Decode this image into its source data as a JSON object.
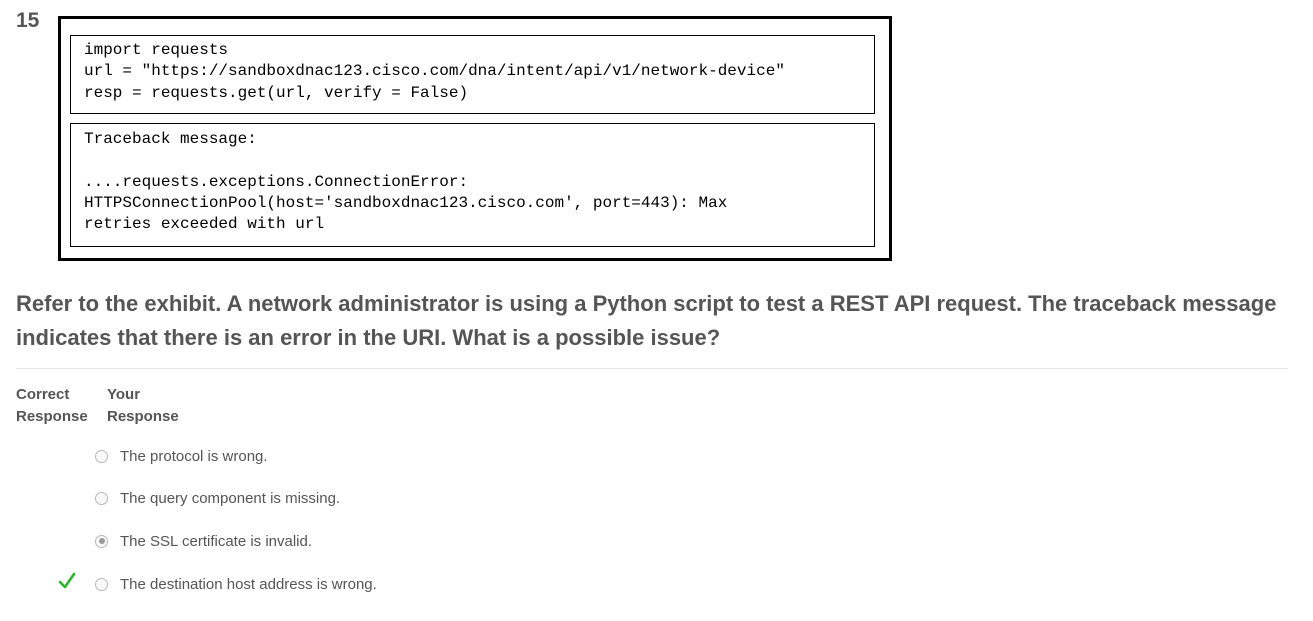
{
  "question": {
    "number": "15",
    "text": "Refer to the exhibit. A network administrator is using a Python script to test a REST API request. The traceback message indicates that there is an error in the URI. What is a possible issue?"
  },
  "exhibit": {
    "request_lines": [
      "import requests",
      "url = \"https://sandboxdnac123.cisco.com/dna/intent/api/v1/network-device\"",
      "resp = requests.get(url, verify = False)"
    ],
    "traceback_lines": [
      "Traceback message:",
      "",
      "....requests.exceptions.ConnectionError:",
      "HTTPSConnectionPool(host='sandboxdnac123.cisco.com', port=443): Max",
      "retries exceeded with url"
    ]
  },
  "headers": {
    "correct_line1": "Correct",
    "correct_line2": "Response",
    "yours_line1": "Your",
    "yours_line2": "Response"
  },
  "options": [
    {
      "label": "The protocol is wrong.",
      "selected": false,
      "correct": false
    },
    {
      "label": "The query component is missing.",
      "selected": false,
      "correct": false
    },
    {
      "label": "The SSL certificate is invalid.",
      "selected": true,
      "correct": false
    },
    {
      "label": "The destination host address is wrong.",
      "selected": false,
      "correct": true
    }
  ],
  "colors": {
    "check": "#2db42d",
    "text": "#555555"
  }
}
